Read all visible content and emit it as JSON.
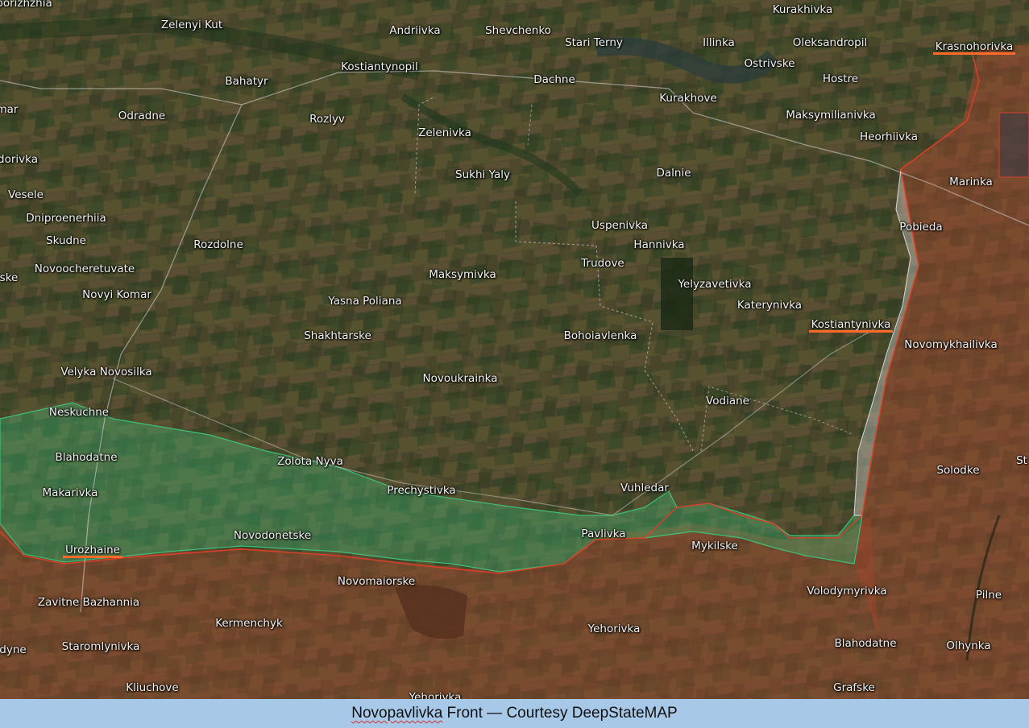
{
  "caption": {
    "name": "Novopavlivka",
    "rest": " Front — Courtesy DeepStateMAP"
  },
  "colors": {
    "terrain": "#4a4a2e",
    "russian_zone": "#a8442e",
    "liberated_zone": "#3fbf7a",
    "gray_zone": "#cfcfcf",
    "underline": "#ff6a2b",
    "caption_bar": "#a8c8e8"
  },
  "places": [
    {
      "id": "zaporizhzhia",
      "name": "porizhzhia"
    },
    {
      "id": "zelenyi-kut",
      "name": "Zelenyi Kut"
    },
    {
      "id": "andriivka",
      "name": "Andriivka"
    },
    {
      "id": "shevchenko",
      "name": "Shevchenko"
    },
    {
      "id": "stari-terny",
      "name": "Stari Terny"
    },
    {
      "id": "illinka",
      "name": "Illinka"
    },
    {
      "id": "kurakhivka",
      "name": "Kurakhivka"
    },
    {
      "id": "oleksandropil",
      "name": "Oleksandropil"
    },
    {
      "id": "krasnohorivka",
      "name": "Krasnohorivka"
    },
    {
      "id": "kostiantynopil",
      "name": "Kostiantynopil"
    },
    {
      "id": "bahatyr",
      "name": "Bahatyr"
    },
    {
      "id": "dachne",
      "name": "Dachne"
    },
    {
      "id": "ostrivske",
      "name": "Ostrivske"
    },
    {
      "id": "hostre",
      "name": "Hostre"
    },
    {
      "id": "komar",
      "name": "mar"
    },
    {
      "id": "odradne",
      "name": "Odradne"
    },
    {
      "id": "rozlyv",
      "name": "Rozlyv"
    },
    {
      "id": "kurakhove",
      "name": "Kurakhove"
    },
    {
      "id": "maksymilianivka",
      "name": "Maksymilianivka"
    },
    {
      "id": "zelenivka",
      "name": "Zelenivka"
    },
    {
      "id": "heorhiivka",
      "name": "Heorhiivka"
    },
    {
      "id": "fedorivka",
      "name": "dorivka"
    },
    {
      "id": "sukhi-yaly",
      "name": "Sukhi Yaly"
    },
    {
      "id": "dalnie",
      "name": "Dalnie"
    },
    {
      "id": "marinka",
      "name": "Marinka"
    },
    {
      "id": "vesele",
      "name": "Vesele"
    },
    {
      "id": "dniproenerhiia",
      "name": "Dniproenerhiia"
    },
    {
      "id": "uspenivka",
      "name": "Uspenivka"
    },
    {
      "id": "pobieda",
      "name": "Pobieda"
    },
    {
      "id": "skudne",
      "name": "Skudne"
    },
    {
      "id": "rozdolne",
      "name": "Rozdolne"
    },
    {
      "id": "hannivka",
      "name": "Hannivka"
    },
    {
      "id": "novoocheretuvate",
      "name": "Novoocheretuvate"
    },
    {
      "id": "trudove",
      "name": "Trudove"
    },
    {
      "id": "maksymivka",
      "name": "Maksymivka"
    },
    {
      "id": "ske",
      "name": "ske"
    },
    {
      "id": "yelyzavetivka",
      "name": "Yelyzavetivka"
    },
    {
      "id": "novyi-komar",
      "name": "Novyi Komar"
    },
    {
      "id": "yasna-poliana",
      "name": "Yasna Poliana"
    },
    {
      "id": "katerynivka",
      "name": "Katerynivka"
    },
    {
      "id": "kostiantynivka",
      "name": "Kostiantynivka"
    },
    {
      "id": "shakhtarske",
      "name": "Shakhtarske"
    },
    {
      "id": "bohoiavlenka",
      "name": "Bohoiavlenka"
    },
    {
      "id": "novomykhailivka",
      "name": "Novomykhailivka"
    },
    {
      "id": "velyka-novosilka",
      "name": "Velyka Novosilka"
    },
    {
      "id": "novoukrainka",
      "name": "Novoukrainka"
    },
    {
      "id": "vodiane",
      "name": "Vodiane"
    },
    {
      "id": "neskuchne",
      "name": "Neskuchne"
    },
    {
      "id": "blahodatne-w",
      "name": "Blahodatne"
    },
    {
      "id": "zolota-nyva",
      "name": "Zolota Nyva"
    },
    {
      "id": "solodke",
      "name": "Solodke"
    },
    {
      "id": "st",
      "name": "St"
    },
    {
      "id": "makarivka",
      "name": "Makarivka"
    },
    {
      "id": "prechystivka",
      "name": "Prechystivka"
    },
    {
      "id": "vuhledar",
      "name": "Vuhledar"
    },
    {
      "id": "pavlivka",
      "name": "Pavlivka"
    },
    {
      "id": "novodonetske",
      "name": "Novodonetske"
    },
    {
      "id": "mykilske",
      "name": "Mykilske"
    },
    {
      "id": "urozhaine",
      "name": "Urozhaine"
    },
    {
      "id": "novomaiorske",
      "name": "Novomaiorske"
    },
    {
      "id": "volodymyrivka",
      "name": "Volodymyrivka"
    },
    {
      "id": "pilne",
      "name": "Pilne"
    },
    {
      "id": "zavitne-bazhannia",
      "name": "Zavitne Bazhannia"
    },
    {
      "id": "kermenchyk",
      "name": "Kermenchyk"
    },
    {
      "id": "yehorivka",
      "name": "Yehorivka"
    },
    {
      "id": "blahodatne-e",
      "name": "Blahodatne"
    },
    {
      "id": "olhynka",
      "name": "Olhynka"
    },
    {
      "id": "dyne",
      "name": "dyne"
    },
    {
      "id": "staromlynivka",
      "name": "Staromlynivka"
    },
    {
      "id": "kliuchove",
      "name": "Kliuchove"
    },
    {
      "id": "grafske",
      "name": "Grafske"
    },
    {
      "id": "yehorivka-bottom",
      "name": "Yehorivka"
    }
  ],
  "highlighted": [
    "krasnohorivka",
    "kostiantynivka",
    "urozhaine"
  ]
}
